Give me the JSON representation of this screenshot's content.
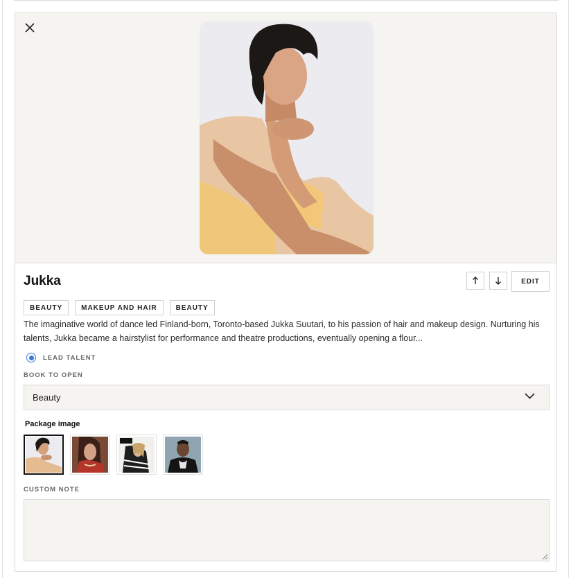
{
  "profile": {
    "name": "Jukka",
    "tags": [
      "BEAUTY",
      "MAKEUP AND HAIR",
      "BEAUTY"
    ],
    "bio": "The imaginative world of dance led Finland-born, Toronto-based Jukka Suutari, to his passion of hair and makeup design. Nurturing his talents, Jukka became a hairstylist for performance and theatre productions, eventually opening a flour..."
  },
  "actions": {
    "move_up_icon": "arrow-up-icon",
    "move_down_icon": "arrow-down-icon",
    "edit_label": "EDIT",
    "close_icon": "close-icon"
  },
  "lead_talent": {
    "label": "LEAD TALENT",
    "checked": true
  },
  "book_to_open": {
    "label": "BOOK TO OPEN",
    "value": "Beauty"
  },
  "package_image": {
    "label": "Package image",
    "selected_index": 0,
    "thumbnails": [
      "portrait-peach",
      "portrait-red-scarf",
      "magazine-cover",
      "portrait-dark-jacket"
    ]
  },
  "custom_note": {
    "label": "CUSTOM NOTE",
    "value": ""
  },
  "colors": {
    "hero_bg": "#f5f4f0",
    "accent": "#3a78d8",
    "border": "#dcdcdc"
  }
}
